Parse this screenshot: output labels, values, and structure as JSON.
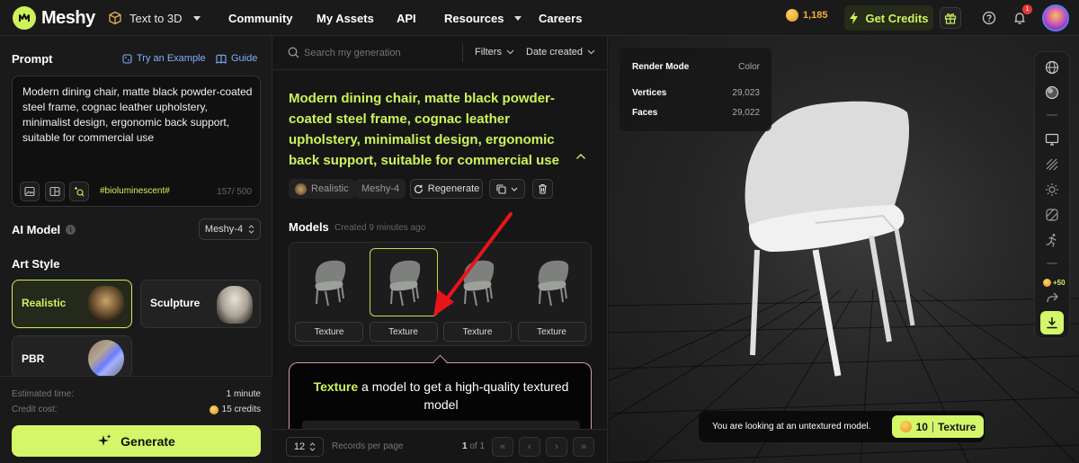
{
  "app": {
    "name": "Meshy"
  },
  "topbar": {
    "mode_label": "Text to 3D",
    "nav": [
      "Community",
      "My Assets",
      "API",
      "Resources",
      "Careers"
    ],
    "credits_balance": "1,185",
    "get_credits_label": "Get Credits",
    "notification_count": "1"
  },
  "left": {
    "prompt_label": "Prompt",
    "try_example_label": "Try an Example",
    "guide_label": "Guide",
    "prompt_text": "Modern dining chair, matte black powder-coated steel frame, cognac leather upholstery, minimalist design, ergonomic back support, suitable for commercial use",
    "hashtag": "#bioluminescent#",
    "char_count": "157/ 500",
    "ai_model_label": "AI Model",
    "ai_model_value": "Meshy-4",
    "art_style_label": "Art Style",
    "art_styles": [
      {
        "name": "Realistic",
        "selected": true
      },
      {
        "name": "Sculpture",
        "selected": false
      },
      {
        "name": "PBR",
        "selected": false
      }
    ],
    "estimated_time_label": "Estimated time:",
    "estimated_time_value": "1 minute",
    "credit_cost_label": "Credit cost:",
    "credit_cost_value": "15 credits",
    "generate_label": "Generate"
  },
  "middle": {
    "search_placeholder": "Search my generation",
    "filters_label": "Filters",
    "sort_label": "Date created",
    "generation_title": "Modern dining chair, matte black powder-coated steel frame, cognac leather upholstery, minimalist design, ergonomic back support, suitable for commercial use",
    "tags": {
      "style": "Realistic",
      "model": "Meshy-4"
    },
    "regenerate_label": "Regenerate",
    "models_label": "Models",
    "models_created": "Created 9 minutes ago",
    "model_cards": [
      {
        "button": "Texture",
        "selected": false
      },
      {
        "button": "Texture",
        "selected": true
      },
      {
        "button": "Texture",
        "selected": false
      },
      {
        "button": "Texture",
        "selected": false
      }
    ],
    "tooltip_highlight": "Texture",
    "tooltip_text": " a model to get a high-quality textured model",
    "pager": {
      "per_page": "12",
      "per_page_label": "Records per page",
      "current": "1",
      "of_label": "of 1"
    }
  },
  "viewport": {
    "info": [
      {
        "key": "Render Mode",
        "value": "Color"
      },
      {
        "key": "Vertices",
        "value": "29,023"
      },
      {
        "key": "Faces",
        "value": "29,022"
      }
    ],
    "bonus": "+50",
    "untextured_message": "You are looking at an untextured model.",
    "texture_cost": "10",
    "texture_label": "Texture"
  },
  "colors": {
    "accent": "#cdf35b",
    "background": "#161616",
    "panel": "#1a1a1a",
    "annotation_arrow": "#e8141c"
  }
}
